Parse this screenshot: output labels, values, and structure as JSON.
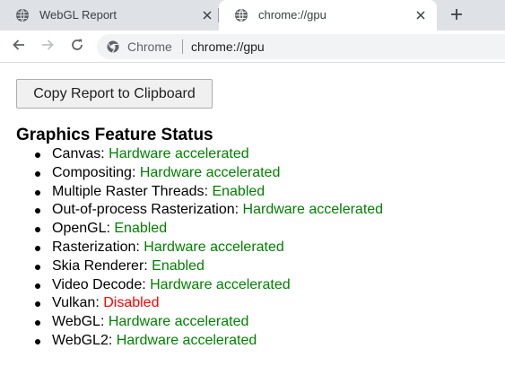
{
  "tabs": [
    {
      "title": "WebGL Report",
      "active": false,
      "icon": "globe-icon"
    },
    {
      "title": "chrome://gpu",
      "active": true,
      "icon": "globe-icon"
    }
  ],
  "toolbar": {
    "omnibox_chip": "Chrome",
    "omnibox_url": "chrome://gpu"
  },
  "page": {
    "copy_button_label": "Copy Report to Clipboard",
    "heading": "Graphics Feature Status",
    "features": [
      {
        "name": "Canvas",
        "status": "Hardware accelerated",
        "ok": true
      },
      {
        "name": "Compositing",
        "status": "Hardware accelerated",
        "ok": true
      },
      {
        "name": "Multiple Raster Threads",
        "status": "Enabled",
        "ok": true
      },
      {
        "name": "Out-of-process Rasterization",
        "status": "Hardware accelerated",
        "ok": true
      },
      {
        "name": "OpenGL",
        "status": "Enabled",
        "ok": true
      },
      {
        "name": "Rasterization",
        "status": "Hardware accelerated",
        "ok": true
      },
      {
        "name": "Skia Renderer",
        "status": "Enabled",
        "ok": true
      },
      {
        "name": "Video Decode",
        "status": "Hardware accelerated",
        "ok": true
      },
      {
        "name": "Vulkan",
        "status": "Disabled",
        "ok": false
      },
      {
        "name": "WebGL",
        "status": "Hardware accelerated",
        "ok": true
      },
      {
        "name": "WebGL2",
        "status": "Hardware accelerated",
        "ok": true
      }
    ]
  },
  "colors": {
    "status_ok": "#008000",
    "status_bad": "#ff0000",
    "tabstrip_bg": "#dee1e6",
    "omnibox_bg": "#f1f3f4"
  }
}
